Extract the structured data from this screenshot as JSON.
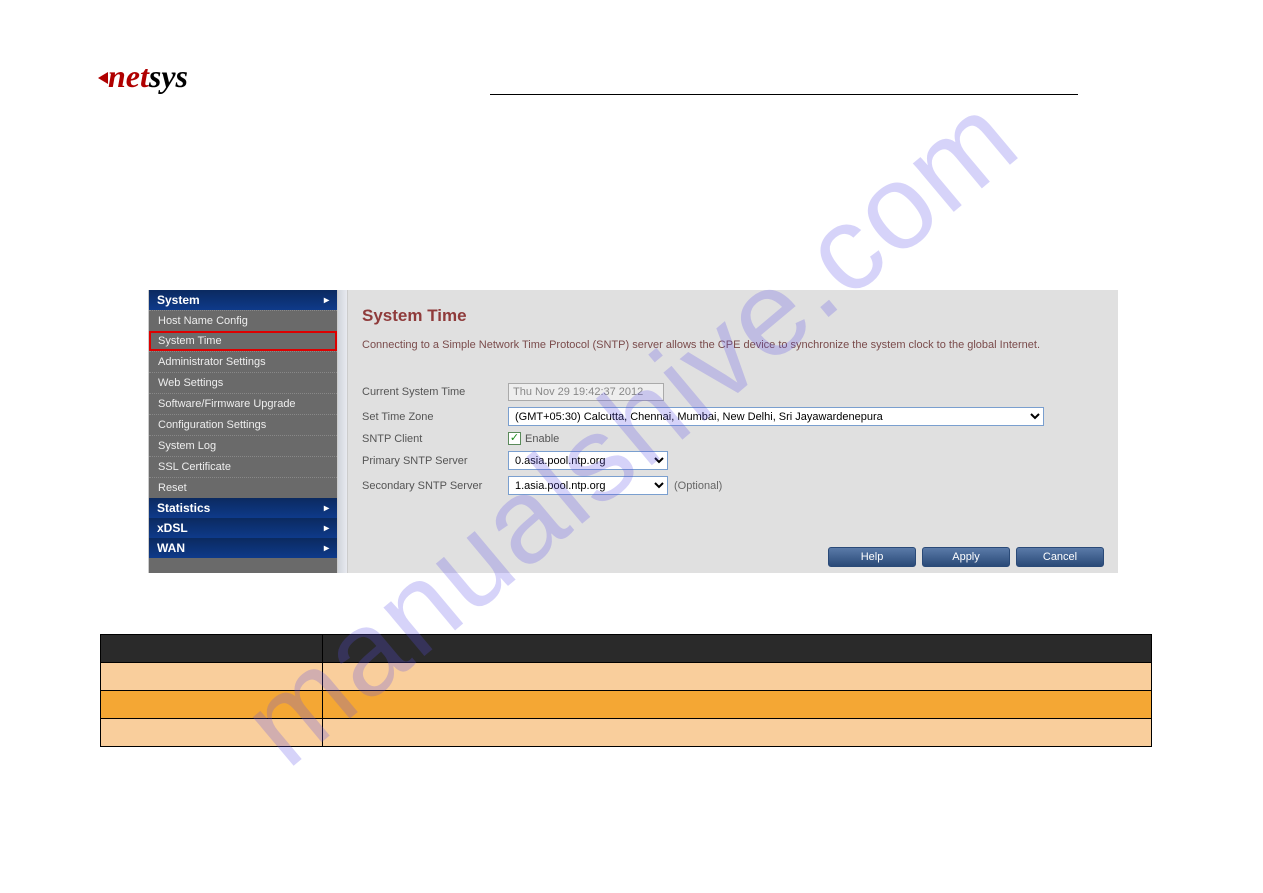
{
  "logo": {
    "left": "net",
    "right": "sys"
  },
  "watermark": "manualshive.com",
  "sidebar": {
    "sections": [
      {
        "label": "System",
        "items": [
          {
            "label": "Host Name Config"
          },
          {
            "label": "System Time",
            "active": true
          },
          {
            "label": "Administrator Settings"
          },
          {
            "label": "Web Settings"
          },
          {
            "label": "Software/Firmware Upgrade"
          },
          {
            "label": "Configuration Settings"
          },
          {
            "label": "System Log"
          },
          {
            "label": "SSL Certificate"
          },
          {
            "label": "Reset"
          }
        ]
      },
      {
        "label": "Statistics",
        "items": []
      },
      {
        "label": "xDSL",
        "items": []
      },
      {
        "label": "WAN",
        "items": []
      }
    ]
  },
  "page": {
    "title": "System Time",
    "description": "Connecting to a Simple Network Time Protocol (SNTP) server allows the CPE device to synchronize the system clock to the global Internet.",
    "fields": {
      "current_time_label": "Current System Time",
      "current_time_value": "Thu Nov 29 19:42:37 2012",
      "timezone_label": "Set Time Zone",
      "timezone_value": "(GMT+05:30) Calcutta, Chennai, Mumbai, New Delhi, Sri Jayawardenepura",
      "sntp_client_label": "SNTP Client",
      "sntp_enable_label": "Enable",
      "primary_label": "Primary SNTP Server",
      "primary_value": "0.asia.pool.ntp.org",
      "secondary_label": "Secondary SNTP Server",
      "secondary_value": "1.asia.pool.ntp.org",
      "optional": "(Optional)"
    },
    "buttons": {
      "help": "Help",
      "apply": "Apply",
      "cancel": "Cancel"
    }
  }
}
